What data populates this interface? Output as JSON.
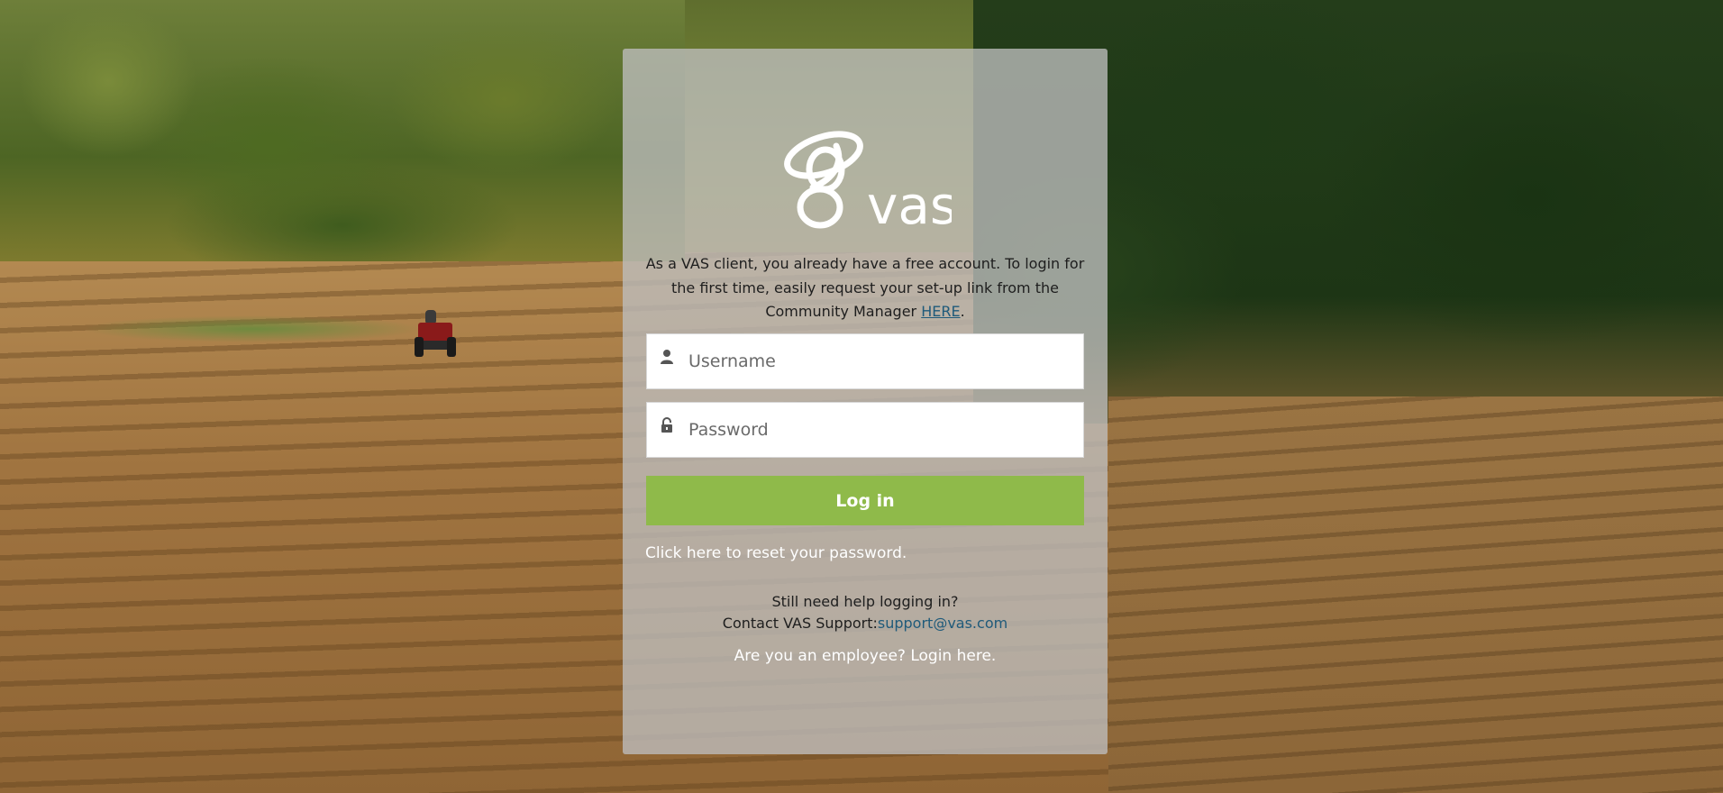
{
  "brand": {
    "logo_text": "vas",
    "logo_color": "#ffffff"
  },
  "intro": {
    "text_before": "As a VAS client, you already have a free account. To login for the first time, easily request your set-up link from the Community Manager ",
    "link_label": "HERE",
    "text_after": "."
  },
  "form": {
    "username": {
      "placeholder": "Username",
      "value": "",
      "icon": "user-icon"
    },
    "password": {
      "placeholder": "Password",
      "value": "",
      "icon": "lock-icon"
    },
    "submit_label": "Log in"
  },
  "links": {
    "reset_password": "Click here to reset your password.",
    "help_question": "Still need help logging in?",
    "contact_label": "Contact VAS Support:",
    "support_email": "support@vas.com",
    "employee_login": "Are you an employee? Login here."
  },
  "colors": {
    "accent_button": "#8fba4a",
    "link": "#1f5a7a",
    "panel": "rgba(190,190,190,0.78)"
  }
}
